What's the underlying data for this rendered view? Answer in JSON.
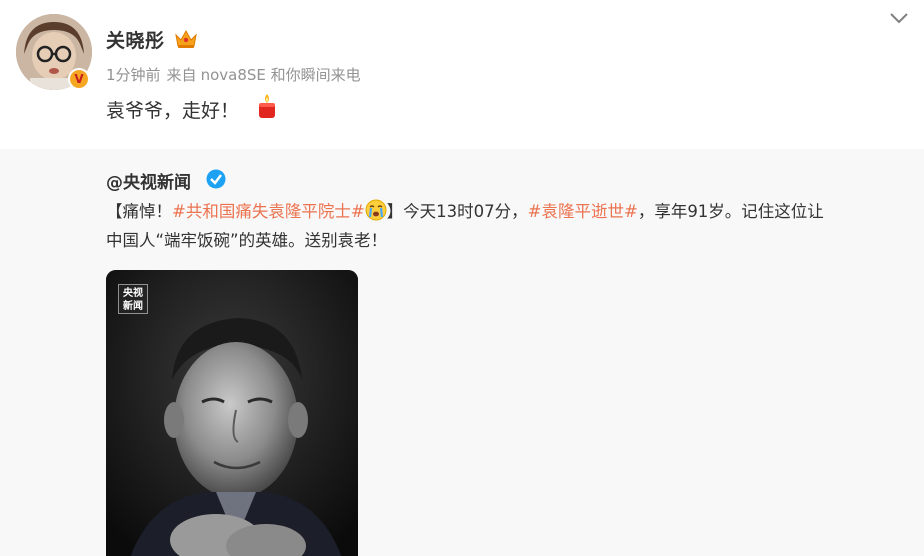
{
  "post": {
    "username": "关晓彤",
    "time": "1分钟前",
    "source_prefix": "来自",
    "source_device": "nova8SE 和你瞬间来电",
    "text": "袁爷爷，走好！"
  },
  "repost": {
    "author": "@央视新闻",
    "text_prefix": "【痛悼！",
    "hashtag1": "#共和国痛失袁隆平院士#",
    "text_mid": "】今天13时07分，",
    "hashtag2": "#袁隆平逝世#",
    "text_suffix": "，享年91岁。记住这位让中国人“端牢饭碗”的英雄。送别袁老！",
    "photo_logo_line1": "央视",
    "photo_logo_line2": "新闻"
  },
  "colors": {
    "hashtag": "#eb7350",
    "verified_blue": "#1da1f2",
    "badge_gold": "#f5a623"
  },
  "icons": [
    "crown-icon",
    "candle-icon",
    "chevron-down-icon",
    "blue-verify-icon",
    "crying-emoji-icon",
    "verified-badge-icon"
  ]
}
